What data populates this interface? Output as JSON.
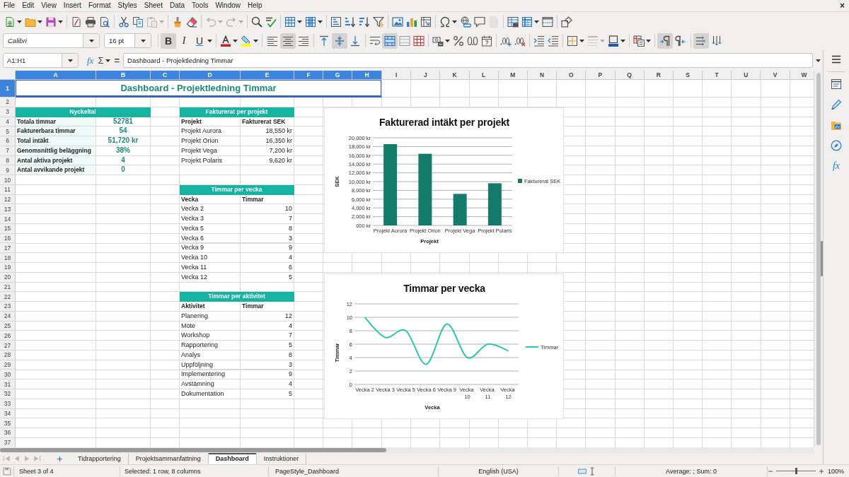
{
  "menu_bar": {
    "items": [
      "File",
      "Edit",
      "View",
      "Insert",
      "Format",
      "Styles",
      "Sheet",
      "Data",
      "Tools",
      "Window",
      "Help"
    ],
    "close": "×"
  },
  "standard_toolbar": {
    "paste": {
      "disabled": true
    },
    "undo": {
      "disabled": true
    },
    "redo": {
      "disabled": true
    },
    "header_footer": {
      "disabled": true
    }
  },
  "formatting_toolbar": {
    "font_name": "Calibri",
    "font_size": "16 pt",
    "bold": {
      "label": "B",
      "on": true
    },
    "italic": {
      "label": "I",
      "on": false
    },
    "underline": {
      "label": "U",
      "on": false
    },
    "horizontal_align": [
      {
        "kind": "left",
        "selected": false
      },
      {
        "kind": "center",
        "selected": true
      },
      {
        "kind": "right",
        "selected": false
      }
    ],
    "vertical_align": [
      {
        "kind": "top",
        "selected": false
      },
      {
        "kind": "center",
        "selected": true
      },
      {
        "kind": "bottom",
        "selected": false
      }
    ],
    "merge_and_center": true,
    "line_style": {
      "disabled": true
    },
    "paragraph_direction": [
      {
        "kind": "left_to_right",
        "selected": true
      },
      {
        "kind": "right_to_left",
        "selected": false
      }
    ],
    "text_orientation": [
      {
        "kind": "left_to_right",
        "selected": true
      },
      {
        "kind": "top_to_bottom",
        "selected": false
      }
    ]
  },
  "formula_bar": {
    "name_box": "A1:H1",
    "function_wizard": "fx",
    "sum": "Σ",
    "equals": "=",
    "content": "Dashboard - Projektledning Timmar"
  },
  "sheet": {
    "columns": [
      {
        "label": "A",
        "selected": true
      },
      {
        "label": "B",
        "selected": true
      },
      {
        "label": "C",
        "selected": true
      },
      {
        "label": "D",
        "selected": true
      },
      {
        "label": "E",
        "selected": true
      },
      {
        "label": "F",
        "selected": true
      },
      {
        "label": "G",
        "selected": true
      },
      {
        "label": "H",
        "selected": true
      },
      {
        "label": "I",
        "selected": false
      },
      {
        "label": "J",
        "selected": false
      },
      {
        "label": "K",
        "selected": false
      },
      {
        "label": "L",
        "selected": false
      },
      {
        "label": "M",
        "selected": false
      },
      {
        "label": "N",
        "selected": false
      },
      {
        "label": "O",
        "selected": false
      },
      {
        "label": "P",
        "selected": false
      },
      {
        "label": "Q",
        "selected": false
      },
      {
        "label": "R",
        "selected": false
      },
      {
        "label": "S",
        "selected": false
      },
      {
        "label": "T",
        "selected": false
      },
      {
        "label": "U",
        "selected": false
      },
      {
        "label": "V",
        "selected": false
      },
      {
        "label": "W",
        "selected": false
      }
    ],
    "rows": [
      {
        "label": "1",
        "selected": true
      },
      {
        "label": "2",
        "selected": false
      },
      {
        "label": "3",
        "selected": false
      },
      {
        "label": "4",
        "selected": false
      },
      {
        "label": "5",
        "selected": false
      },
      {
        "label": "6",
        "selected": false
      },
      {
        "label": "7",
        "selected": false
      },
      {
        "label": "8",
        "selected": false
      },
      {
        "label": "9",
        "selected": false
      },
      {
        "label": "10",
        "selected": false
      },
      {
        "label": "11",
        "selected": false
      },
      {
        "label": "12",
        "selected": false
      },
      {
        "label": "13",
        "selected": false
      },
      {
        "label": "14",
        "selected": false
      },
      {
        "label": "15",
        "selected": false
      },
      {
        "label": "16",
        "selected": false
      },
      {
        "label": "17",
        "selected": false
      },
      {
        "label": "18",
        "selected": false
      },
      {
        "label": "19",
        "selected": false
      },
      {
        "label": "20",
        "selected": false
      },
      {
        "label": "21",
        "selected": false
      },
      {
        "label": "22",
        "selected": false
      },
      {
        "label": "23",
        "selected": false
      },
      {
        "label": "24",
        "selected": false
      },
      {
        "label": "25",
        "selected": false
      },
      {
        "label": "26",
        "selected": false
      },
      {
        "label": "27",
        "selected": false
      },
      {
        "label": "28",
        "selected": false
      },
      {
        "label": "29",
        "selected": false
      },
      {
        "label": "30",
        "selected": false
      },
      {
        "label": "31",
        "selected": false
      },
      {
        "label": "32",
        "selected": false
      },
      {
        "label": "33",
        "selected": false
      },
      {
        "label": "34",
        "selected": false
      },
      {
        "label": "35",
        "selected": false
      },
      {
        "label": "36",
        "selected": false
      },
      {
        "label": "37",
        "selected": false
      }
    ],
    "title": {
      "text": "Dashboard - Projektledning Timmar",
      "selected": true
    },
    "kpi_table": {
      "header": "Nyckeltal",
      "rows": [
        {
          "label": "Totala timmar",
          "value": "52781"
        },
        {
          "label": "Fakturerbara timmar",
          "value": "54"
        },
        {
          "label": "Total intäkt",
          "value": "51,720 kr"
        },
        {
          "label": "Genomsnittlig beläggning",
          "value": "38%"
        },
        {
          "label": "Antal aktiva projekt",
          "value": "4"
        },
        {
          "label": "Antal avvikande projekt",
          "value": "0"
        }
      ]
    },
    "billing_table": {
      "header": "Fakturerat per projekt",
      "columns": [
        "Projekt",
        "Fakturerat SEK"
      ],
      "rows": [
        {
          "project": "Projekt Aurora",
          "amount": "18,550 kr"
        },
        {
          "project": "Projekt Orion",
          "amount": "16,350 kr"
        },
        {
          "project": "Projekt Vega",
          "amount": "7,200 kr"
        },
        {
          "project": "Projekt Polaris",
          "amount": "9,620 kr"
        }
      ]
    },
    "weekly_table": {
      "header": "Timmar per vecka",
      "columns": [
        "Vecka",
        "Timmar"
      ],
      "rows": [
        {
          "week": "Vecka 2",
          "hours": "10"
        },
        {
          "week": "Vecka 3",
          "hours": "7"
        },
        {
          "week": "Vecka 5",
          "hours": "8"
        },
        {
          "week": "Vecka 6",
          "hours": "3"
        },
        {
          "week": "Vecka 9",
          "hours": "9"
        },
        {
          "week": "Vecka 10",
          "hours": "4"
        },
        {
          "week": "Vecka 11",
          "hours": "6"
        },
        {
          "week": "Vecka 12",
          "hours": "5"
        }
      ]
    },
    "activity_table": {
      "header": "Timmar per aktivitet",
      "columns": [
        "Aktivitet",
        "Timmar"
      ],
      "rows": [
        {
          "activity": "Planering",
          "hours": "12"
        },
        {
          "activity": "Möte",
          "hours": "4"
        },
        {
          "activity": "Workshop",
          "hours": "7"
        },
        {
          "activity": "Rapportering",
          "hours": "5"
        },
        {
          "activity": "Analys",
          "hours": "8"
        },
        {
          "activity": "Uppföljning",
          "hours": "3"
        },
        {
          "activity": "Implementering",
          "hours": "9"
        },
        {
          "activity": "Avstämning",
          "hours": "4"
        },
        {
          "activity": "Dokumentation",
          "hours": "5"
        }
      ]
    }
  },
  "revenue_chart": {
    "chart_data": {
      "type": "bar",
      "title": "Fakturerad intäkt per projekt",
      "xlabel": "Projekt",
      "ylabel": "SEK",
      "categories": [
        "Projekt Aurora",
        "Projekt Orion",
        "Projekt Vega",
        "Projekt Polaris"
      ],
      "series": [
        {
          "name": "Fakturerat SEK",
          "color": "#137a6c",
          "values": [
            18550,
            16350,
            7200,
            9620
          ]
        }
      ],
      "ylim": [
        0,
        20000
      ],
      "yticks": [
        {
          "value": 0,
          "label": "000 kr"
        },
        {
          "value": 2000,
          "label": "2,000 kr"
        },
        {
          "value": 4000,
          "label": "4,000 kr"
        },
        {
          "value": 6000,
          "label": "6,000 kr"
        },
        {
          "value": 8000,
          "label": "8,000 kr"
        },
        {
          "value": 10000,
          "label": "10,000 kr"
        },
        {
          "value": 12000,
          "label": "12,000 kr"
        },
        {
          "value": 14000,
          "label": "14,000 kr"
        },
        {
          "value": 16000,
          "label": "16,000 kr"
        },
        {
          "value": 18000,
          "label": "18,000 kr"
        },
        {
          "value": 20000,
          "label": "20,000 kr"
        }
      ],
      "grid": true
    }
  },
  "hours_chart": {
    "chart_data": {
      "type": "line",
      "title": "Timmar per vecka",
      "xlabel": "Vecka",
      "ylabel": "Timmar",
      "categories": [
        "Vecka 2",
        "Vecka 3",
        "Vecka 5",
        "Vecka 6",
        "Vecka 9",
        "Vecka 10",
        "Vecka 11",
        "Vecka 12"
      ],
      "series": [
        {
          "name": "Timmar",
          "color": "#2ec4b6",
          "values": [
            10,
            7,
            8,
            3,
            9,
            4,
            6,
            5
          ]
        }
      ],
      "ylim": [
        0,
        12
      ],
      "yticks": [
        0,
        2,
        4,
        6,
        8,
        10,
        12
      ],
      "grid": true
    }
  },
  "sheet_navigation": {
    "disabled": true
  },
  "sheet_tabs": [
    {
      "label": "Tidrapportering",
      "selected": false
    },
    {
      "label": "Projektsammanfattning",
      "selected": false
    },
    {
      "label": "Dashboard",
      "selected": true
    },
    {
      "label": "Instruktioner",
      "selected": false
    }
  ],
  "sidebar": {
    "functions": "fx"
  },
  "status_bar": {
    "sheet_position": "Sheet 3 of 4",
    "selection": "Selected: 1 row, 8 columns",
    "page_style": "PageStyle_Dashboard",
    "language": "English (USA)",
    "summary": "Average: ; Sum: 0",
    "zoom": {
      "level": 0.5,
      "reading": "100%"
    }
  }
}
